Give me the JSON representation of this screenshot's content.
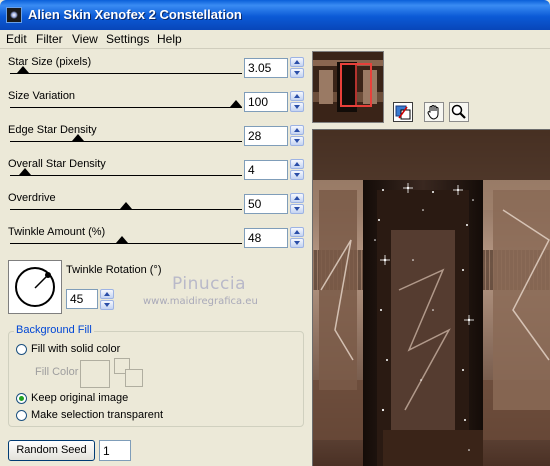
{
  "window": {
    "title": "Alien Skin Xenofex 2 Constellation"
  },
  "menu": [
    "Edit",
    "Filter",
    "View",
    "Settings",
    "Help"
  ],
  "sliders": [
    {
      "label": "Star Size (pixels)",
      "value": "3.05",
      "position": 0.03
    },
    {
      "label": "Size Variation",
      "value": "100",
      "position": 1.0
    },
    {
      "label": "Edge Star Density",
      "value": "28",
      "position": 0.28
    },
    {
      "label": "Overall Star Density",
      "value": "4",
      "position": 0.04
    },
    {
      "label": "Overdrive",
      "value": "50",
      "position": 0.5
    },
    {
      "label": "Twinkle Amount (%)",
      "value": "48",
      "position": 0.48
    }
  ],
  "rotation": {
    "label": "Twinkle Rotation (°)",
    "value": "45"
  },
  "watermark": {
    "name": "Pinuccia",
    "url": "www.maidiregrafica.eu"
  },
  "background_fill": {
    "title": "Background Fill",
    "options": [
      {
        "label": "Fill with solid color",
        "checked": false
      },
      {
        "label": "Keep original image",
        "checked": true
      },
      {
        "label": "Make selection transparent",
        "checked": false
      }
    ],
    "fill_color_label": "Fill Color"
  },
  "random_seed": {
    "button_label": "Random Seed",
    "value": "1"
  },
  "tools": [
    "preview-compare-icon",
    "hand-icon",
    "magnifier-icon"
  ],
  "colors": {
    "title_bar": "#0a5fd8",
    "group_title": "#0046d5",
    "preview_bg": "#241812",
    "accent_selection": "#e8403a"
  }
}
